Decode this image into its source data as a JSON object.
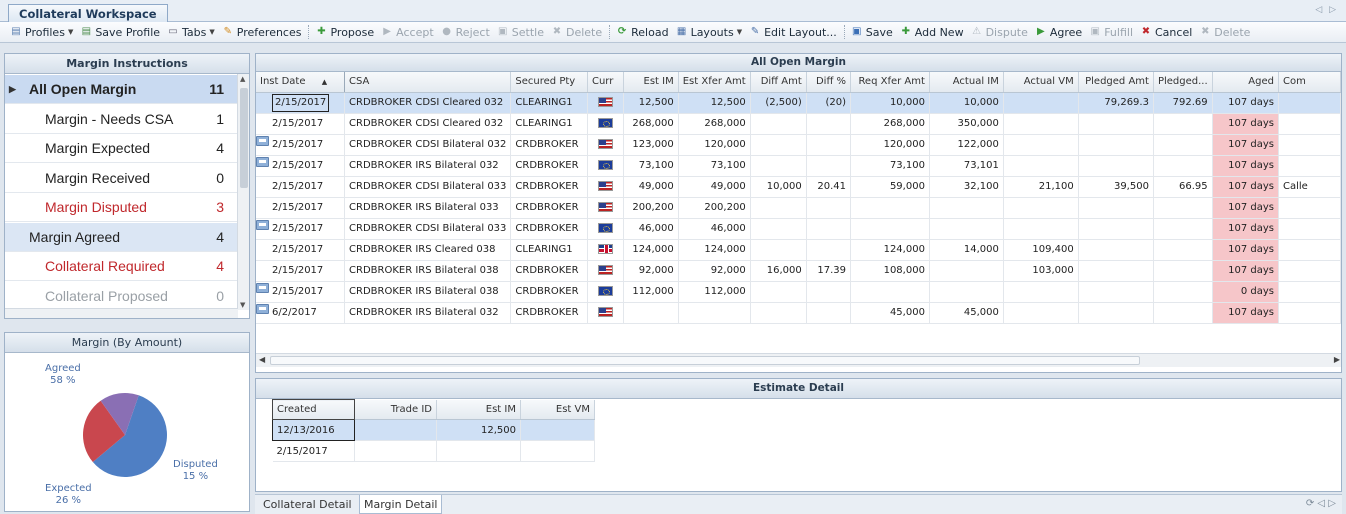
{
  "window": {
    "tab_title": "Collateral Workspace"
  },
  "toolbar": {
    "items": [
      {
        "label": "Profiles",
        "icon": "profiles-icon",
        "dropdown": true,
        "enabled": true
      },
      {
        "label": "Save Profile",
        "icon": "save-profile-icon",
        "enabled": true
      },
      {
        "label": "Tabs",
        "icon": "tabs-icon",
        "dropdown": true,
        "enabled": true
      },
      {
        "label": "Preferences",
        "icon": "preferences-icon",
        "enabled": true
      },
      {
        "label": "Propose",
        "icon": "propose-icon",
        "enabled": true
      },
      {
        "label": "Accept",
        "icon": "accept-icon",
        "enabled": false
      },
      {
        "label": "Reject",
        "icon": "reject-icon",
        "enabled": false
      },
      {
        "label": "Settle",
        "icon": "settle-icon",
        "enabled": false
      },
      {
        "label": "Delete",
        "icon": "delete-icon",
        "enabled": false
      },
      {
        "label": "Reload",
        "icon": "reload-icon",
        "enabled": true
      },
      {
        "label": "Layouts",
        "icon": "layouts-icon",
        "dropdown": true,
        "enabled": true
      },
      {
        "label": "Edit Layout...",
        "icon": "edit-layout-icon",
        "enabled": true
      },
      {
        "label": "Save",
        "icon": "save-icon",
        "enabled": true
      },
      {
        "label": "Add New",
        "icon": "add-new-icon",
        "enabled": true
      },
      {
        "label": "Dispute",
        "icon": "dispute-icon",
        "enabled": false
      },
      {
        "label": "Agree",
        "icon": "agree-icon",
        "enabled": true
      },
      {
        "label": "Fulfill",
        "icon": "fulfill-icon",
        "enabled": false
      },
      {
        "label": "Cancel",
        "icon": "cancel-icon",
        "enabled": true
      },
      {
        "label": "Delete",
        "icon": "delete-icon",
        "enabled": false
      }
    ]
  },
  "margin_instructions": {
    "header": "Margin Instructions",
    "items": [
      {
        "label": "All Open Margin",
        "count": "11"
      },
      {
        "label": "Margin - Needs CSA",
        "count": "1"
      },
      {
        "label": "Margin Expected",
        "count": "4"
      },
      {
        "label": "Margin Received",
        "count": "0"
      },
      {
        "label": "Margin Disputed",
        "count": "3"
      },
      {
        "label": "Margin Agreed",
        "count": "4"
      },
      {
        "label": "Collateral Required",
        "count": "4"
      },
      {
        "label": "Collateral Proposed",
        "count": "0"
      }
    ]
  },
  "pie": {
    "header": "Margin (By Amount)",
    "agreed_label": "Agreed",
    "agreed_pct": "58 %",
    "disputed_label": "Disputed",
    "disputed_pct": "15 %",
    "expected_label": "Expected",
    "expected_pct": "26 %",
    "colors": {
      "agreed": "#4f7fc4",
      "expected": "#c9474e",
      "disputed": "#8a6fb4"
    }
  },
  "grid": {
    "title": "All Open Margin",
    "columns": [
      "Inst Date",
      "CSA",
      "Secured Pty",
      "Curr",
      "Est IM",
      "Est Xfer Amt",
      "Diff Amt",
      "Diff %",
      "Req Xfer Amt",
      "Actual IM",
      "Actual VM",
      "Pledged Amt",
      "Pledged...",
      "Aged",
      "Com"
    ],
    "rows": [
      {
        "date": "2/15/2017",
        "csa": "CRDBROKER CDSI Cleared 032",
        "pty": "CLEARING1",
        "curr": "us",
        "est_im": "12,500",
        "est_xfer": "12,500",
        "diff_amt": "(2,500)",
        "diff_pct": "(20)",
        "req_xfer": "10,000",
        "actual_im": "10,000",
        "actual_vm": "",
        "pledged_amt": "79,269.3",
        "pledged2": "792.69",
        "aged": "107 days",
        "com": "",
        "icon": false
      },
      {
        "date": "2/15/2017",
        "csa": "CRDBROKER CDSI Cleared 032",
        "pty": "CLEARING1",
        "curr": "eu",
        "est_im": "268,000",
        "est_xfer": "268,000",
        "diff_amt": "",
        "diff_pct": "",
        "req_xfer": "268,000",
        "actual_im": "350,000",
        "actual_vm": "",
        "pledged_amt": "",
        "pledged2": "",
        "aged": "107 days",
        "com": "",
        "icon": false
      },
      {
        "date": "2/15/2017",
        "csa": "CRDBROKER CDSI Bilateral 032",
        "pty": "CRDBROKER",
        "curr": "us",
        "est_im": "123,000",
        "est_xfer": "120,000",
        "diff_amt": "",
        "diff_pct": "",
        "req_xfer": "120,000",
        "actual_im": "122,000",
        "actual_vm": "",
        "pledged_amt": "",
        "pledged2": "",
        "aged": "107 days",
        "com": "",
        "icon": true
      },
      {
        "date": "2/15/2017",
        "csa": "CRDBROKER IRS Bilateral 032",
        "pty": "CRDBROKER",
        "curr": "eu",
        "est_im": "73,100",
        "est_xfer": "73,100",
        "diff_amt": "",
        "diff_pct": "",
        "req_xfer": "73,100",
        "actual_im": "73,101",
        "actual_vm": "",
        "pledged_amt": "",
        "pledged2": "",
        "aged": "107 days",
        "com": "",
        "icon": true
      },
      {
        "date": "2/15/2017",
        "csa": "CRDBROKER CDSI Bilateral 033",
        "pty": "CRDBROKER",
        "curr": "us",
        "est_im": "49,000",
        "est_xfer": "49,000",
        "diff_amt": "10,000",
        "diff_pct": "20.41",
        "req_xfer": "59,000",
        "actual_im": "32,100",
        "actual_vm": "21,100",
        "pledged_amt": "39,500",
        "pledged2": "66.95",
        "aged": "107 days",
        "com": "Calle",
        "icon": false
      },
      {
        "date": "2/15/2017",
        "csa": "CRDBROKER IRS Bilateral 033",
        "pty": "CRDBROKER",
        "curr": "us",
        "est_im": "200,200",
        "est_xfer": "200,200",
        "diff_amt": "",
        "diff_pct": "",
        "req_xfer": "",
        "actual_im": "",
        "actual_vm": "",
        "pledged_amt": "",
        "pledged2": "",
        "aged": "107 days",
        "com": "",
        "icon": false
      },
      {
        "date": "2/15/2017",
        "csa": "CRDBROKER CDSI Bilateral 033",
        "pty": "CRDBROKER",
        "curr": "eu",
        "est_im": "46,000",
        "est_xfer": "46,000",
        "diff_amt": "",
        "diff_pct": "",
        "req_xfer": "",
        "actual_im": "",
        "actual_vm": "",
        "pledged_amt": "",
        "pledged2": "",
        "aged": "107 days",
        "com": "",
        "icon": true
      },
      {
        "date": "2/15/2017",
        "csa": "CRDBROKER IRS Cleared 038",
        "pty": "CLEARING1",
        "curr": "gb",
        "est_im": "124,000",
        "est_xfer": "124,000",
        "diff_amt": "",
        "diff_pct": "",
        "req_xfer": "124,000",
        "actual_im": "14,000",
        "actual_vm": "109,400",
        "pledged_amt": "",
        "pledged2": "",
        "aged": "107 days",
        "com": "",
        "icon": false
      },
      {
        "date": "2/15/2017",
        "csa": "CRDBROKER IRS Bilateral 038",
        "pty": "CRDBROKER",
        "curr": "us",
        "est_im": "92,000",
        "est_xfer": "92,000",
        "diff_amt": "16,000",
        "diff_pct": "17.39",
        "req_xfer": "108,000",
        "actual_im": "",
        "actual_vm": "103,000",
        "pledged_amt": "",
        "pledged2": "",
        "aged": "107 days",
        "com": "",
        "icon": false
      },
      {
        "date": "2/15/2017",
        "csa": "CRDBROKER IRS Bilateral 038",
        "pty": "CRDBROKER",
        "curr": "eu",
        "est_im": "112,000",
        "est_xfer": "112,000",
        "diff_amt": "",
        "diff_pct": "",
        "req_xfer": "",
        "actual_im": "",
        "actual_vm": "",
        "pledged_amt": "",
        "pledged2": "",
        "aged": "0 days",
        "com": "",
        "icon": true
      },
      {
        "date": "6/2/2017",
        "csa": "CRDBROKER IRS Bilateral 032",
        "pty": "CRDBROKER",
        "curr": "us",
        "est_im": "",
        "est_xfer": "",
        "diff_amt": "",
        "diff_pct": "",
        "req_xfer": "45,000",
        "actual_im": "45,000",
        "actual_vm": "",
        "pledged_amt": "",
        "pledged2": "",
        "aged": "107 days",
        "com": "",
        "icon": true
      }
    ]
  },
  "estimate_detail": {
    "title": "Estimate Detail",
    "columns": [
      "Created",
      "Trade ID",
      "Est IM",
      "Est VM"
    ],
    "rows": [
      {
        "created": "12/13/2016",
        "trade_id": "",
        "est_im": "12,500",
        "est_vm": ""
      },
      {
        "created": "2/15/2017",
        "trade_id": "",
        "est_im": "",
        "est_vm": ""
      }
    ]
  },
  "bottom_tabs": [
    "Collateral Detail",
    "Margin Detail"
  ]
}
